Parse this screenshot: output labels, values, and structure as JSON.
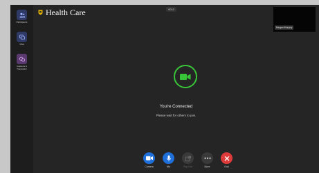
{
  "sidebar": {
    "items": [
      {
        "label": "Participants",
        "icon": "people-icon"
      },
      {
        "label": "Chat",
        "icon": "chat-icon"
      },
      {
        "label": "Captions &\nTranslation",
        "icon": "captions-icon"
      }
    ]
  },
  "header": {
    "brand": "Health Care",
    "meeting_id": "0012"
  },
  "self_view": {
    "name": "Megan Murphy"
  },
  "status": {
    "title": "You're Connected",
    "subtitle": "Please wait for others to join."
  },
  "controls": [
    {
      "label": "Camera",
      "icon": "camera-icon",
      "color": "#1e6fd9",
      "enabled": true
    },
    {
      "label": "Mic",
      "icon": "mic-icon",
      "color": "#1e6fd9",
      "enabled": true
    },
    {
      "label": "Pop Out",
      "icon": "popout-icon",
      "color": "#3a3a3a",
      "enabled": false
    },
    {
      "label": "More",
      "icon": "more-icon",
      "color": "#3a3a3a",
      "enabled": true
    },
    {
      "label": "End",
      "icon": "end-icon",
      "color": "#e03b3b",
      "enabled": true
    }
  ],
  "colors": {
    "accent": "#1e6fd9",
    "connected": "#3ac43a",
    "end": "#e03b3b",
    "sidebar_icon_bg": "#2f3a66"
  }
}
